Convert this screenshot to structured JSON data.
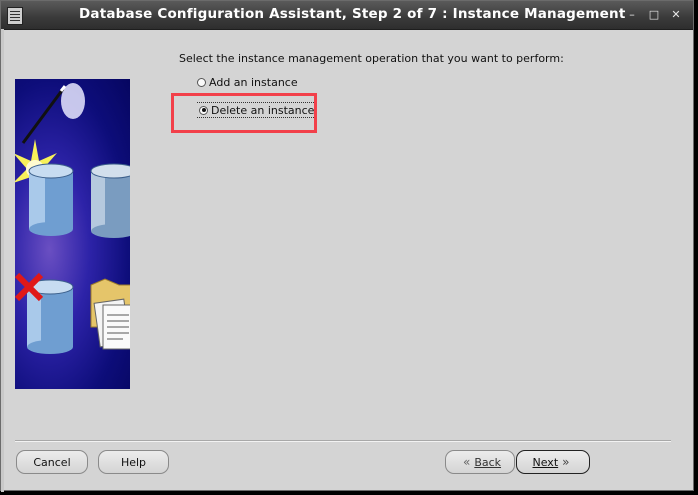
{
  "window": {
    "title": "Database Configuration Assistant, Step 2 of 7 : Instance Management",
    "controls": {
      "minimize": "–",
      "maximize": "□",
      "close": "✕"
    }
  },
  "main": {
    "prompt": "Select the instance management operation that you want to perform:",
    "options": [
      {
        "label": "Add an instance",
        "selected": false
      },
      {
        "label": "Delete an instance",
        "selected": true
      }
    ]
  },
  "buttons": {
    "cancel": "Cancel",
    "help": "Help",
    "back": "Back",
    "next": "Next",
    "back_icon": "«",
    "next_icon": "»"
  },
  "colors": {
    "highlight": "#f2404a",
    "panel_bg": "#d4d4d4",
    "titlebar": "#3a3a3a"
  }
}
